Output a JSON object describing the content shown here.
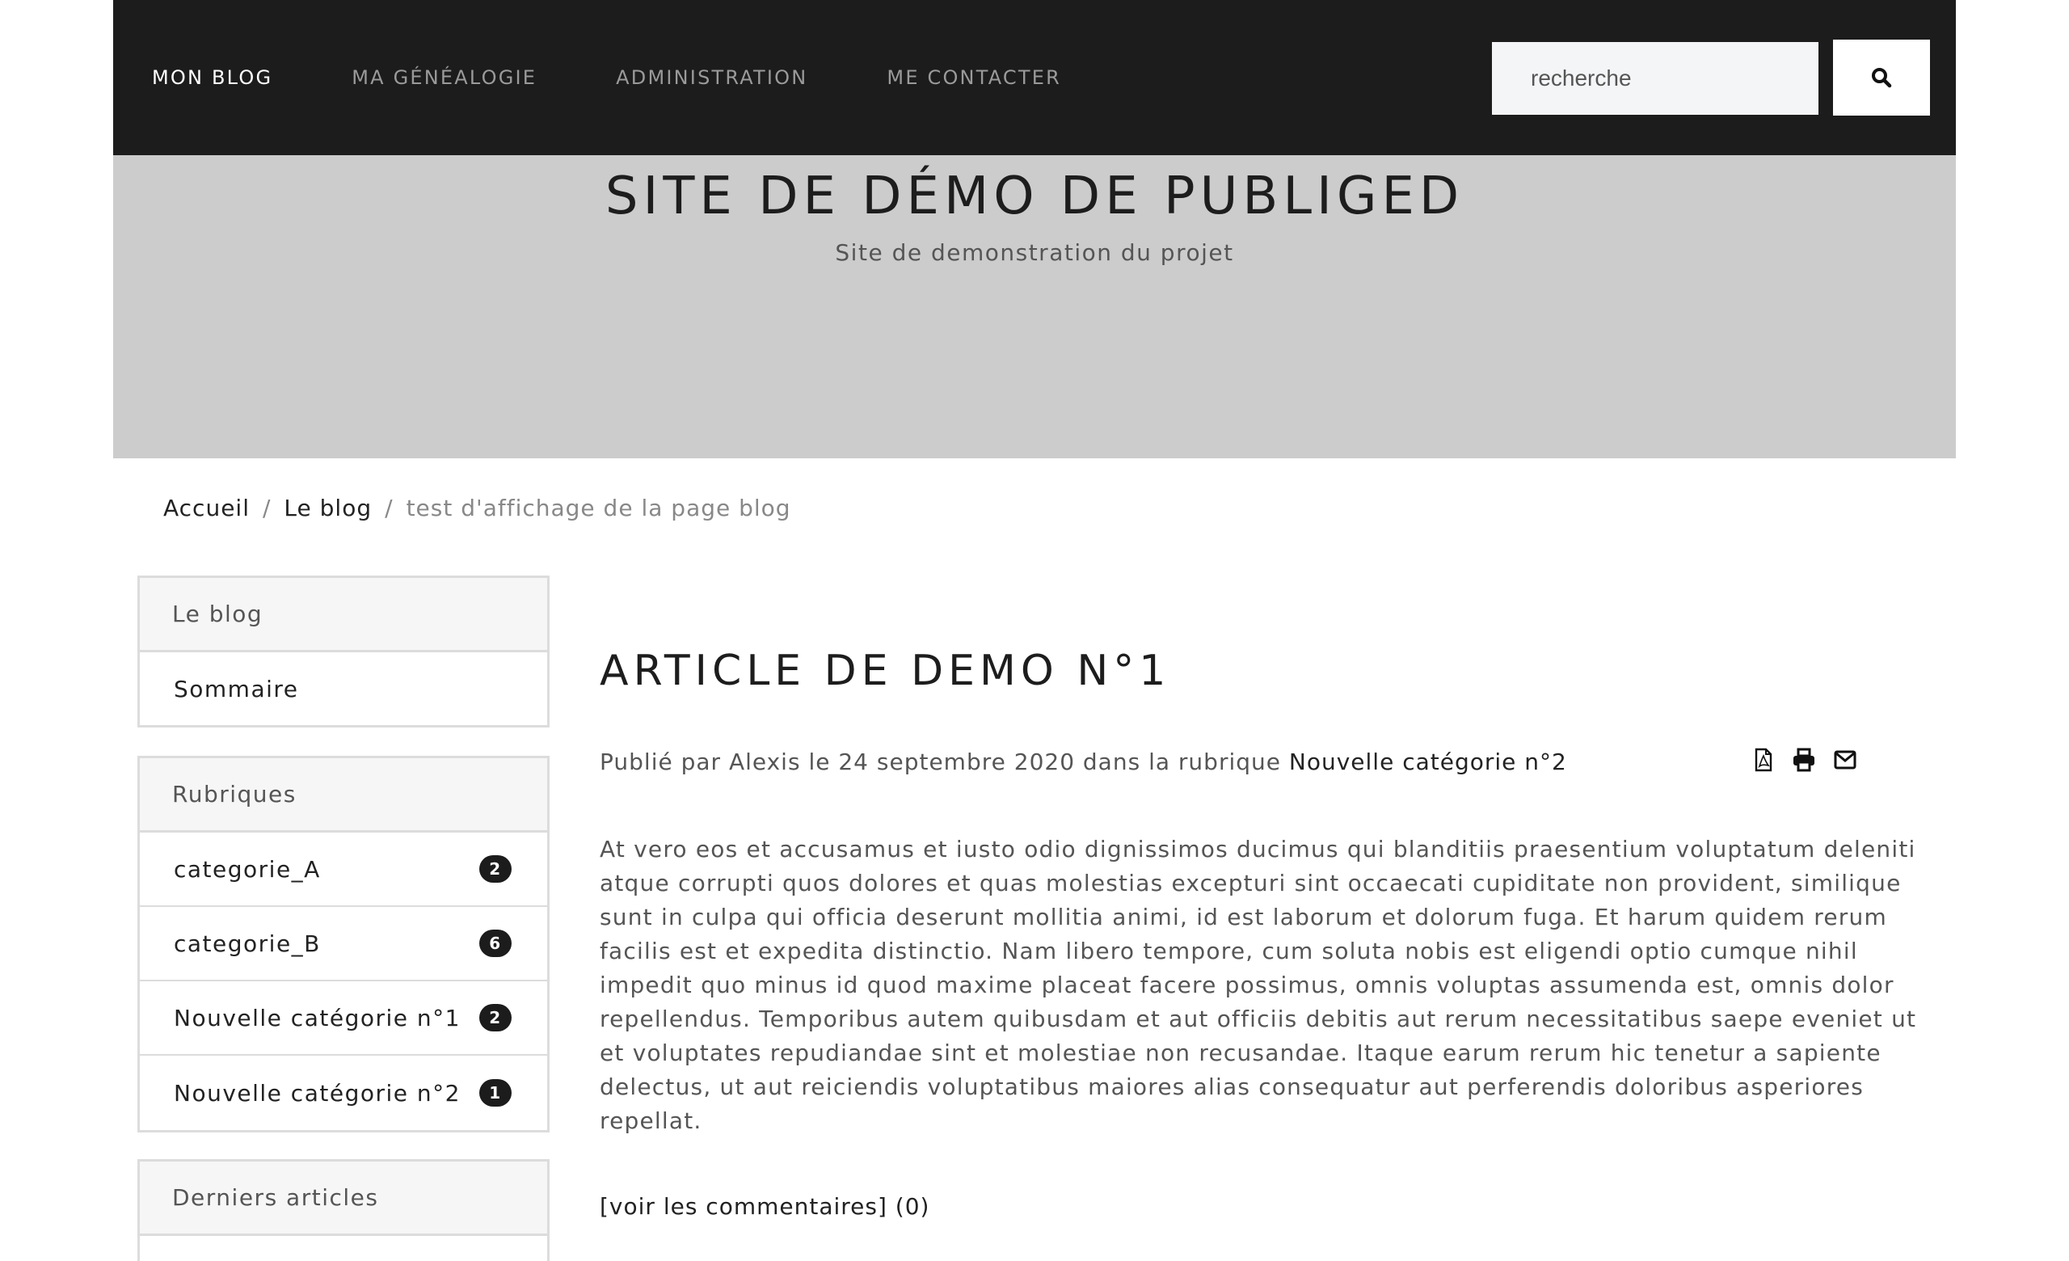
{
  "nav": {
    "items": [
      {
        "label": "MON BLOG",
        "active": true
      },
      {
        "label": "MA GÉNÉALOGIE",
        "active": false
      },
      {
        "label": "ADMINISTRATION",
        "active": false
      },
      {
        "label": "ME CONTACTER",
        "active": false
      }
    ],
    "search_placeholder": "recherche"
  },
  "hero": {
    "title": "SITE DE DÉMO DE PUBLIGED",
    "subtitle": "Site de demonstration du projet"
  },
  "breadcrumb": {
    "home": "Accueil",
    "blog": "Le blog",
    "current": "test d'affichage de la page blog",
    "separator": "/"
  },
  "sidebar": {
    "blog_panel": {
      "header": "Le blog",
      "items": [
        {
          "label": "Sommaire"
        }
      ]
    },
    "rubriques_panel": {
      "header": "Rubriques",
      "items": [
        {
          "label": "categorie_A",
          "count": "2"
        },
        {
          "label": "categorie_B",
          "count": "6"
        },
        {
          "label": "Nouvelle catégorie n°1",
          "count": "2"
        },
        {
          "label": "Nouvelle catégorie n°2",
          "count": "1"
        }
      ]
    },
    "latest_panel": {
      "header": "Derniers articles"
    }
  },
  "article": {
    "title": "ARTICLE DE DEMO N°1",
    "meta_prefix": "Publié par Alexis le 24 septembre 2020 dans la rubrique ",
    "meta_category": "Nouvelle catégorie n°2",
    "body": "At vero eos et accusamus et iusto odio dignissimos ducimus qui blanditiis praesentium voluptatum deleniti atque corrupti quos dolores et quas molestias excepturi sint occaecati cupiditate non provident, similique sunt in culpa qui officia deserunt mollitia animi, id est laborum et dolorum fuga. Et harum quidem rerum facilis est et expedita distinctio. Nam libero tempore, cum soluta nobis est eligendi optio cumque nihil impedit quo minus id quod maxime placeat facere possimus, omnis voluptas assumenda est, omnis dolor repellendus. Temporibus autem quibusdam et aut officiis debitis aut rerum necessitatibus saepe eveniet ut et voluptates repudiandae sint et molestiae non recusandae. Itaque earum rerum hic tenetur a sapiente delectus, ut aut reiciendis voluptatibus maiores alias consequatur aut perferendis doloribus asperiores repellat.",
    "comments_label": "[voir les commentaires] (0)",
    "actions": [
      "pdf-icon",
      "print-icon",
      "email-icon"
    ]
  },
  "colors": {
    "navbar_bg": "#1c1c1c",
    "hero_bg": "#cccccc",
    "accent_dark": "#1c1c1c"
  }
}
